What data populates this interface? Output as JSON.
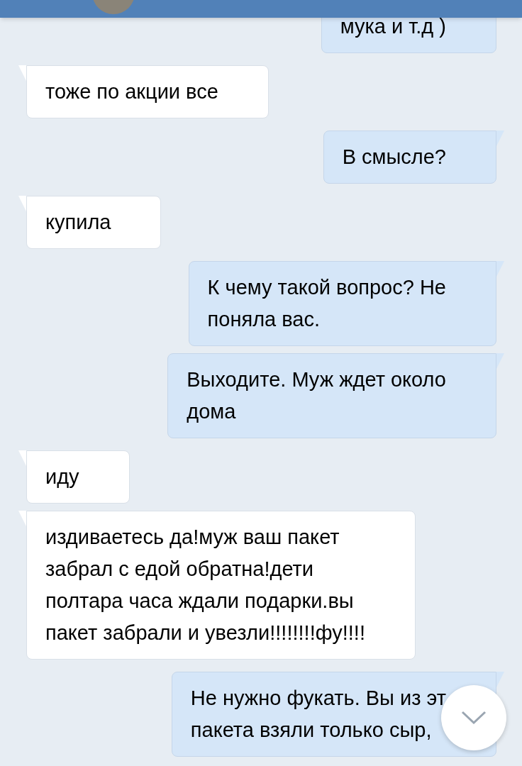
{
  "messages": [
    {
      "kind": "outgoing",
      "text": "мука и т.д )"
    },
    {
      "kind": "incoming",
      "text": "тоже по акции все"
    },
    {
      "kind": "outgoing",
      "text": "В смысле?"
    },
    {
      "kind": "incoming",
      "text": "купила"
    },
    {
      "kind": "outgoing",
      "text": "К чему такой вопрос? Не\nпоняла вас."
    },
    {
      "kind": "outgoing",
      "text": "Выходите. Муж ждет около\nдома"
    },
    {
      "kind": "incoming",
      "text": "иду"
    },
    {
      "kind": "incoming",
      "text": "издиваетесь да!муж ваш пакет\nзабрал с едой обратна!дети\nполтара часа ждали подарки.вы\nпакет забрали и увезли!!!!!!!!фу!!!!"
    },
    {
      "kind": "outgoing",
      "text": "Не нужно фукать. Вы из эт\nпакета взяли только сыр,"
    }
  ]
}
